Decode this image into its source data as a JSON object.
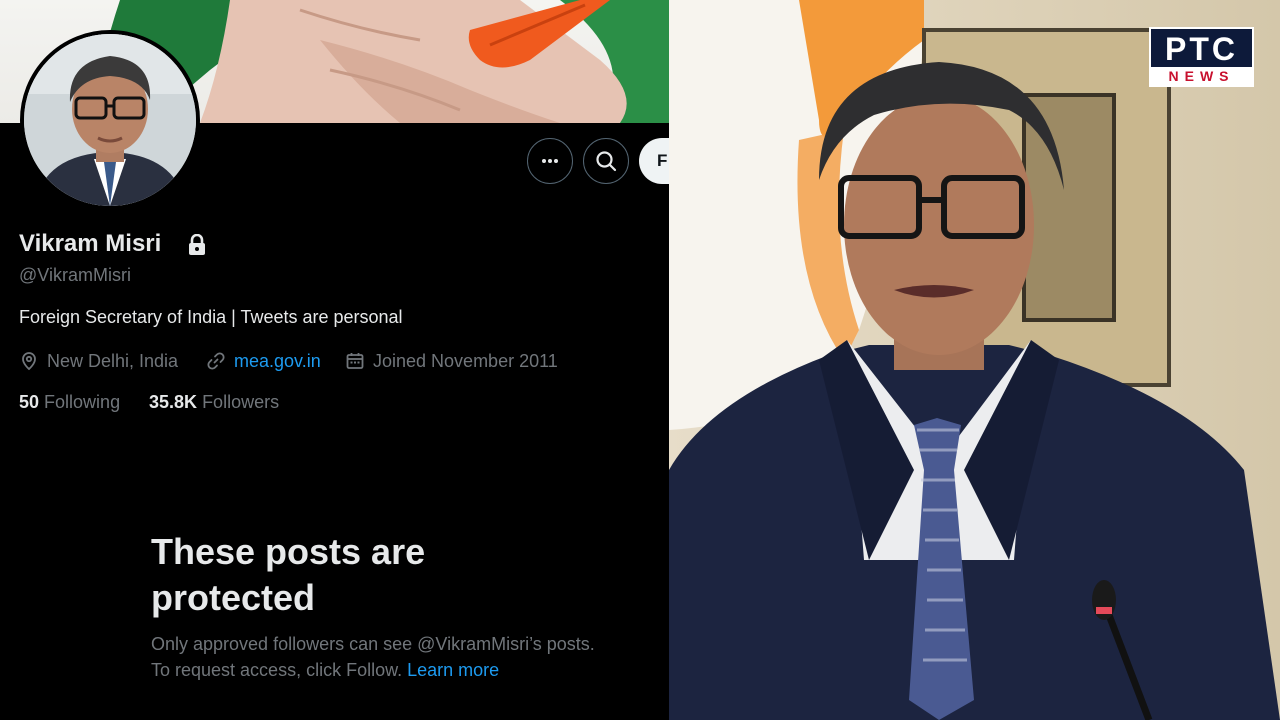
{
  "profile": {
    "display_name": "Vikram Misri",
    "handle": "@VikramMisri",
    "bio": "Foreign Secretary of India | Tweets are personal",
    "location": "New Delhi, India",
    "website": "mea.gov.in",
    "joined": "Joined November 2011",
    "following_count": "50",
    "following_label": "Following",
    "followers_count": "35.8K",
    "followers_label": "Followers",
    "follow_button_label": "F"
  },
  "protected": {
    "title": "These posts are protected",
    "body": "Only approved followers can see @VikramMisri’s posts. To request access, click Follow.",
    "link_label": "Learn more"
  },
  "logo": {
    "top": "PTC",
    "bottom": "NEWS"
  },
  "icons": {
    "more": "more-icon",
    "search": "search-icon",
    "lock": "lock-icon",
    "location": "location-pin-icon",
    "link": "link-icon",
    "calendar": "calendar-icon"
  },
  "colors": {
    "accent": "#1d9bf0",
    "text_primary": "#e7e9ea",
    "text_secondary": "#71767b",
    "logo_red": "#c8102e",
    "logo_navy": "#0d1a3a"
  }
}
